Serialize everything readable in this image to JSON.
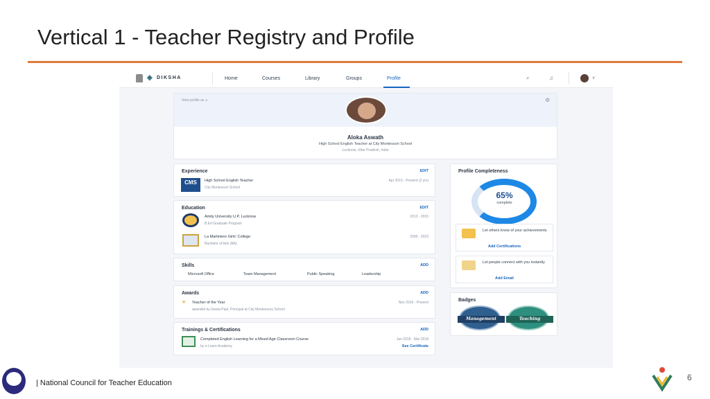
{
  "slide": {
    "title": "Vertical 1 - Teacher Registry and Profile",
    "footer": "| National Council for Teacher Education",
    "page_number": "6",
    "accent_color": "#e07a3a"
  },
  "app": {
    "logo_text": "DIKSHA",
    "nav": [
      "Home",
      "Courses",
      "Library",
      "Groups",
      "Profile"
    ],
    "active_nav": "Profile"
  },
  "profile": {
    "view_as": "View profile as ∨",
    "name": "Aloka Aswath",
    "role": "High School English Teacher at City Montessori School",
    "location": "Lucknow, Uttar Pradesh, India"
  },
  "experience": {
    "title": "Experience",
    "action": "EDIT",
    "entries": [
      {
        "title": "High School English Teacher",
        "sub": "City Montessori School",
        "date": "Apr 2015 - Present (3 yrs)",
        "icon": "CMS"
      }
    ]
  },
  "education": {
    "title": "Education",
    "action": "EDIT",
    "entries": [
      {
        "title": "Amity University U.P, Lucknow",
        "sub": "B.Ed Graduate Program",
        "date": "2013 - 2015"
      },
      {
        "title": "La Martiniere Girls' College",
        "sub": "Bachelor of Arts (BA)",
        "date": "2006 - 2010"
      }
    ]
  },
  "skills": {
    "title": "Skills",
    "action": "ADD",
    "items": [
      "Microsoft Office",
      "Team Management",
      "Public Speaking",
      "Leadership"
    ]
  },
  "awards": {
    "title": "Awards",
    "action": "ADD",
    "entries": [
      {
        "title": "Teacher of the Year",
        "sub": "awarded by Geeta Paul, Principal at City Montessory School",
        "date": "Nov 2016 - Present"
      }
    ]
  },
  "trainings": {
    "title": "Trainings & Certifications",
    "action": "ADD",
    "entries": [
      {
        "title": "Completed English Learning for a Mixed Age Classroom Course",
        "sub": "by e-Learn Academy",
        "date": "Jan 2018 - Mar 2018",
        "link": "See Certificate"
      }
    ]
  },
  "completeness": {
    "title": "Profile Completeness",
    "percent_label": "65%",
    "percent_value": 65,
    "sub": "complete",
    "tips": [
      {
        "text": "Let others know of your achievements",
        "link": "Add Certifications"
      },
      {
        "text": "Let people connect with you instantly",
        "link": "Add Email"
      }
    ]
  },
  "badges": {
    "title": "Badges",
    "items": [
      {
        "label": "Management",
        "color": "#2f5f8f"
      },
      {
        "label": "Teaching",
        "color": "#2e8f7f"
      }
    ]
  }
}
